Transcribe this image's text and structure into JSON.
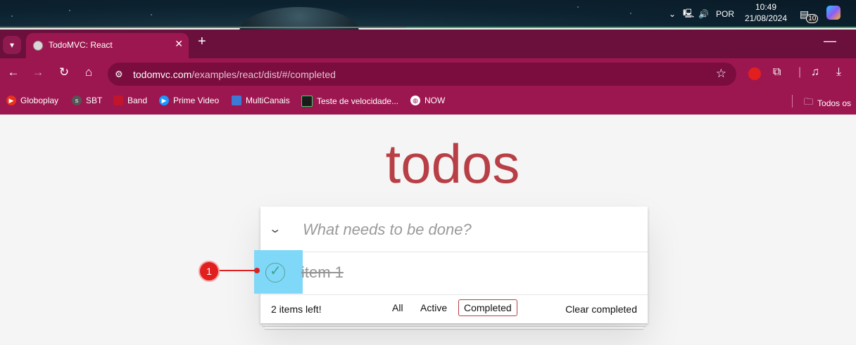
{
  "taskbar": {
    "language": "POR",
    "time": "10:49",
    "date": "21/08/2024",
    "notification_count": "10"
  },
  "browser": {
    "tab_title": "TodoMVC: React",
    "url_host": "todomvc.com",
    "url_path": "/examples/react/dist/#/completed",
    "bookmarks": [
      {
        "label": "Globoplay",
        "icon": "globoplay-icon",
        "color": "#e8321e"
      },
      {
        "label": "SBT",
        "icon": "sbt-icon",
        "color": "#555555"
      },
      {
        "label": "Band",
        "icon": "band-icon",
        "color": "#c0152c"
      },
      {
        "label": "Prime Video",
        "icon": "prime-video-icon",
        "color": "#1a98ff"
      },
      {
        "label": "MultiCanais",
        "icon": "multicanais-icon",
        "color": "#3d7ad6"
      },
      {
        "label": "Teste de velocidade...",
        "icon": "speedtest-icon",
        "color": "#1b1b1b"
      },
      {
        "label": "NOW",
        "icon": "globe-icon",
        "color": "#ffffff"
      }
    ],
    "other_bookmarks": "Todos os"
  },
  "todo": {
    "heading": "todos",
    "new_todo_placeholder": "What needs to be done?",
    "items": [
      {
        "label": "item 1",
        "completed": true
      }
    ],
    "items_left": "2 items left!",
    "filters": [
      "All",
      "Active",
      "Completed"
    ],
    "selected_filter": "Completed",
    "clear_completed": "Clear completed"
  },
  "annotation": {
    "badge": "1"
  },
  "colors": {
    "accent": "#b83f45",
    "chrome": "#9c1750",
    "highlight": "#7fd8f8"
  }
}
